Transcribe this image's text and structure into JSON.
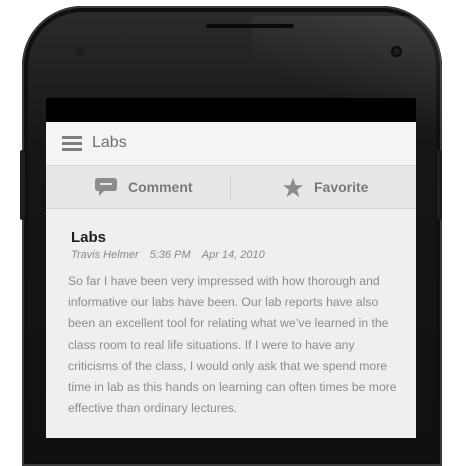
{
  "app": {
    "title": "Labs"
  },
  "actions": {
    "comment_label": "Comment",
    "favorite_label": "Favorite",
    "comment_icon": "comment-bubble-icon",
    "favorite_icon": "star-icon"
  },
  "post": {
    "title": "Labs",
    "author": "Travis Helmer",
    "time": "5:36 PM",
    "date": "Apr 14, 2010",
    "body": "So far I have been very impressed with how thorough and informative our labs have been. Our lab reports have also been an excellent tool for relating what we’ve learned in the class room to real life situations. If I were to have any criticisms of the class, I would only ask that we spend more time in lab as this hands on learning can often times be more effective than ordinary lectures."
  },
  "colors": {
    "screen_bg": "#efefef",
    "action_bar": "#f4f4f4",
    "button_row": "#e7e7e7",
    "icon_gray": "#8c8c8c"
  }
}
